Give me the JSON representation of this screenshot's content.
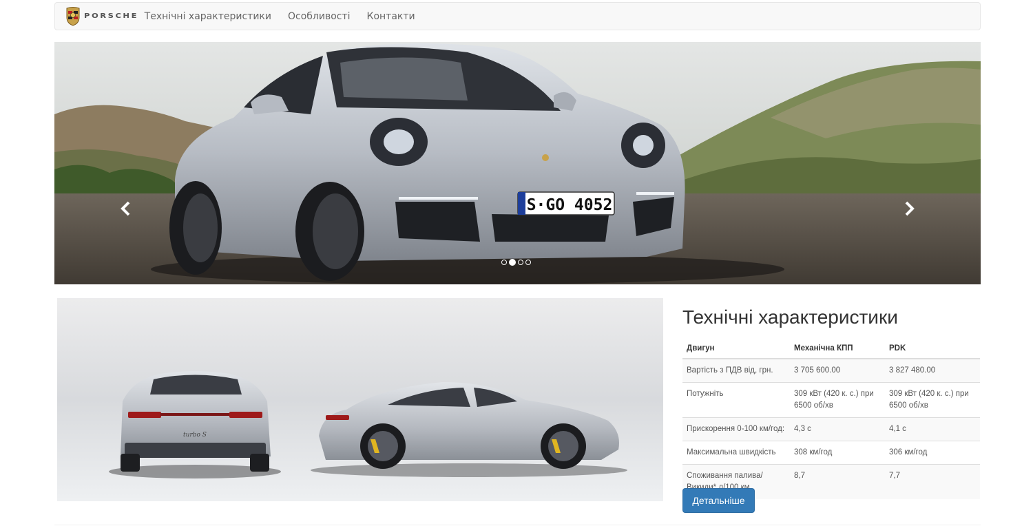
{
  "brand": {
    "wordmark": "PORSCHE",
    "logo_icon": "porsche-crest-icon"
  },
  "nav": {
    "items": [
      {
        "label": "Технічні характеристики"
      },
      {
        "label": "Особливості"
      },
      {
        "label": "Контакти"
      }
    ]
  },
  "carousel": {
    "slide_count": 4,
    "active_index": 1,
    "plate_text": "S·GO 4052",
    "prev_icon": "chevron-left-icon",
    "next_icon": "chevron-right-icon"
  },
  "showcase": {
    "badge_text": "turbo S"
  },
  "specs": {
    "title": "Технічні характеристики",
    "headers": [
      "Двигун",
      "Механічна КПП",
      "PDK"
    ],
    "rows": [
      [
        "Вартість з ПДВ від, грн.",
        "3 705 600.00",
        "3 827 480.00"
      ],
      [
        "Потужніть",
        "309 кВт (420 к. с.) при 6500 об/хв",
        "309 кВт (420 к. с.) при 6500 об/хв"
      ],
      [
        "Прискорення 0-100 км/год:",
        "4,3 с",
        "4,1 с"
      ],
      [
        "Максимальна швидкість",
        "308 км/год",
        "306 км/год"
      ],
      [
        "Споживання палива/ Викиди* л/100 км",
        "8,7",
        "7,7"
      ]
    ],
    "button_label": "Детальніше"
  },
  "colors": {
    "primary": "#337ab7",
    "navbar_bg": "#f8f8f8",
    "car_silver": "#c9ccd1"
  }
}
